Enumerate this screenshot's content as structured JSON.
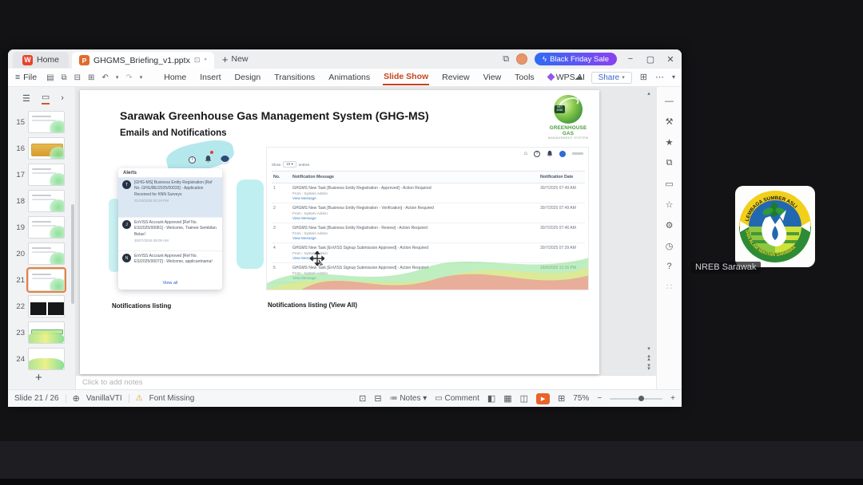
{
  "titlebar": {
    "home_tab": "Home",
    "doc_tab": "GHGMS_Briefing_v1.pptx",
    "new_label": "New",
    "promo": "Black Friday Sale"
  },
  "menubar": {
    "file": "File",
    "items": [
      "Home",
      "Insert",
      "Design",
      "Transitions",
      "Animations",
      "Slide Show",
      "Review",
      "View",
      "Tools",
      "WPS AI"
    ],
    "share": "Share"
  },
  "thumbs": {
    "items": [
      {
        "num": "15"
      },
      {
        "num": "16"
      },
      {
        "num": "17"
      },
      {
        "num": "18"
      },
      {
        "num": "19"
      },
      {
        "num": "20"
      },
      {
        "num": "21"
      },
      {
        "num": "22"
      },
      {
        "num": "23"
      },
      {
        "num": "24"
      }
    ]
  },
  "slide": {
    "title": "Sarawak Greenhouse Gas Management System (GHG-MS)",
    "subtitle": "Emails and Notifications",
    "logo": {
      "badge": "NET 2050",
      "line1": "GREENHOUSE GAS",
      "line2": "MANAGEMENT SYSTEM"
    },
    "alerts": {
      "header": "Alerts",
      "view_all": "View all",
      "items": [
        {
          "initial": "T",
          "text": "[GHG-MS] Business Entity Registration [Ref No. GHG/BE/2025/00033] - Application Received for KNN Surveys",
          "time": "21/10/2025 02:19 PM"
        },
        {
          "initial": "J",
          "text": "EnVISS Account Approved [Ref No. ES/2025/00081] - Welcome, Trainee Sembilan Belas!",
          "time": "30/07/2025 09:09 AM"
        },
        {
          "initial": "N",
          "text": "EnVISS Account Approved [Ref No. ES/2025/00072] - Welcome, applicantnama!",
          "time": ""
        }
      ]
    },
    "shot": {
      "show": "Show",
      "show_value": "10",
      "entries": "entries",
      "headers": {
        "no": "No.",
        "message": "Notification Message",
        "date": "Notification Date"
      },
      "rows": [
        {
          "no": "1",
          "message": "GHGMS New Task [Business Entity Registration - Approved] - Action Required",
          "from": "From : System Admin",
          "link": "View Message",
          "date": "30/7/2025 07:49 AM"
        },
        {
          "no": "2",
          "message": "GHGMS New Task [Business Entity Registration - Verification] - Action Required",
          "from": "From : System Admin",
          "link": "View Message",
          "date": "30/7/2025 07:49 AM"
        },
        {
          "no": "3",
          "message": "GHGMS New Task [Business Entity Registration - Review] - Action Required",
          "from": "From : System Admin",
          "link": "View Message",
          "date": "30/7/2025 07:46 AM"
        },
        {
          "no": "4",
          "message": "GHGMS New Task [EnVISS Signup Submission Approved] - Action Required",
          "from": "From : System Admin",
          "link": "View Message",
          "date": "30/7/2025 07:39 AM"
        },
        {
          "no": "5",
          "message": "GHGMS New Task [EnVISS Signup Submission Approved] - Action Required",
          "from": "From : System Admin",
          "link": "View Message",
          "date": "16/6/2025 12:16 PM"
        }
      ]
    },
    "captions": {
      "left": "Notifications listing",
      "right": "Notifications listing (View All)"
    }
  },
  "notes_placeholder": "Click to add notes",
  "status": {
    "slide": "Slide 21 / 26",
    "lang": "VanillaVTI",
    "warning": "Font Missing",
    "notes": "Notes",
    "comment": "Comment",
    "zoom": "75%"
  },
  "meet": {
    "participant": "NREB Sarawak",
    "logo_top": "LEMBAGA SUMBER ASLI",
    "logo_bottom": "DAN ALAM SEKITAR SARAWAK"
  }
}
